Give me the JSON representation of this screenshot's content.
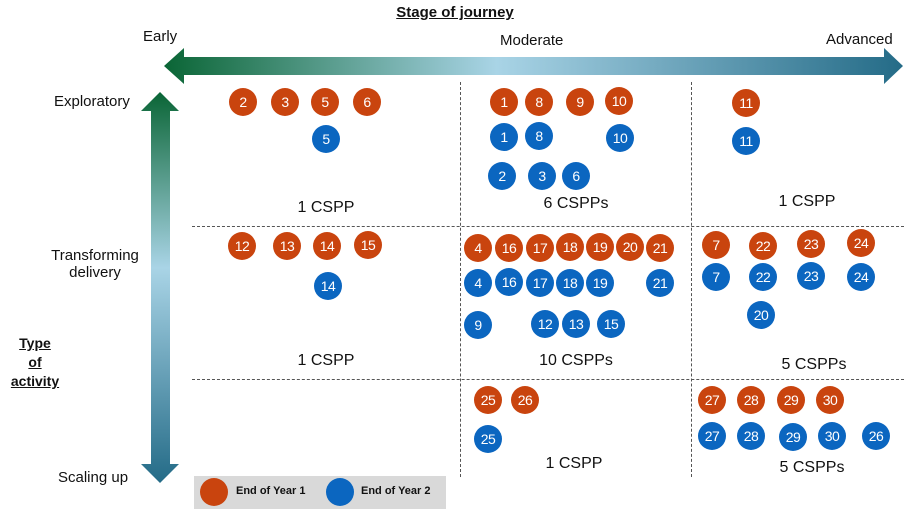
{
  "title": "Stage of journey",
  "x_axis": {
    "labels": [
      "Early",
      "Moderate",
      "Advanced"
    ]
  },
  "y_axis": {
    "title_lines": [
      "Type",
      "of",
      "activity"
    ],
    "labels": [
      "Exploratory",
      "Transforming delivery",
      "Scaling up"
    ]
  },
  "legend": [
    {
      "label": "End of Year 1",
      "color": "#c9440e"
    },
    {
      "label": "End of Year 2",
      "color": "#0b66c0"
    }
  ],
  "colors": {
    "year1": "#c9440e",
    "year2": "#0b66c0",
    "arrow_dark": "#0a6535",
    "arrow_light": "#a9d4e6",
    "arrow_end": "#246b87"
  },
  "cells": [
    {
      "row": "Exploratory",
      "col": "Early",
      "count": "1 CSPP",
      "year1": [
        "2",
        "3",
        "5",
        "6"
      ],
      "year2": [
        "5"
      ]
    },
    {
      "row": "Exploratory",
      "col": "Moderate",
      "count": "6 CSPPs",
      "year1": [
        "1",
        "8",
        "9",
        "10"
      ],
      "year2": [
        "1",
        "8",
        "10",
        "2",
        "3",
        "6"
      ]
    },
    {
      "row": "Exploratory",
      "col": "Advanced",
      "count": "1 CSPP",
      "year1": [
        "11"
      ],
      "year2": [
        "11"
      ]
    },
    {
      "row": "Transforming delivery",
      "col": "Early",
      "count": "1 CSPP",
      "year1": [
        "12",
        "13",
        "14",
        "15"
      ],
      "year2": [
        "14"
      ]
    },
    {
      "row": "Transforming delivery",
      "col": "Moderate",
      "count": "10 CSPPs",
      "year1": [
        "4",
        "16",
        "17",
        "18",
        "19",
        "20",
        "21"
      ],
      "year2": [
        "4",
        "16",
        "17",
        "18",
        "19",
        "21",
        "9",
        "12",
        "13",
        "15"
      ]
    },
    {
      "row": "Transforming delivery",
      "col": "Advanced",
      "count": "5 CSPPs",
      "year1": [
        "7",
        "22",
        "23",
        "24"
      ],
      "year2": [
        "7",
        "22",
        "23",
        "24",
        "20"
      ]
    },
    {
      "row": "Scaling up",
      "col": "Moderate",
      "count": "1 CSPP",
      "year1": [
        "25",
        "26"
      ],
      "year2": [
        "25"
      ]
    },
    {
      "row": "Scaling up",
      "col": "Advanced",
      "count": "5 CSPPs",
      "year1": [
        "27",
        "28",
        "29",
        "30"
      ],
      "year2": [
        "27",
        "28",
        "29",
        "30",
        "26"
      ]
    }
  ]
}
